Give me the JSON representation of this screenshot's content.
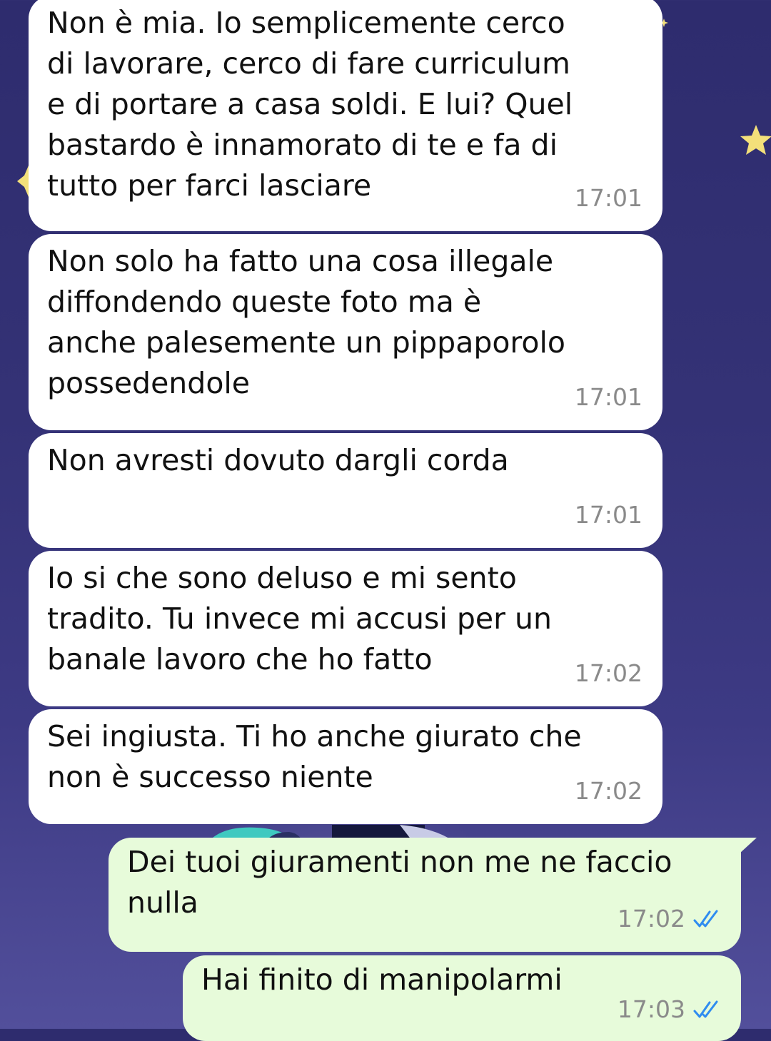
{
  "chat": {
    "messages": [
      {
        "direction": "incoming",
        "text": "Non è mia. Io semplicemente cerco\ndi lavorare, cerco di fare curriculum\ne di portare a casa soldi. E lui? Quel\nbastardo è innamorato di te e fa di\ntutto per farci lasciare",
        "time": "17:01"
      },
      {
        "direction": "incoming",
        "text": "Non solo ha fatto una cosa illegale\ndiffondendo queste foto ma è\nanche palesemente un pippaporolo\npossedendole",
        "time": "17:01"
      },
      {
        "direction": "incoming",
        "text": "Non avresti dovuto dargli corda",
        "time": "17:01"
      },
      {
        "direction": "incoming",
        "text": "Io si che sono deluso e mi sento\ntradito. Tu invece mi accusi per un\nbanale lavoro che ho fatto",
        "time": "17:02"
      },
      {
        "direction": "incoming",
        "text": "Sei ingiusta. Ti ho anche giurato che\nnon è successo niente",
        "time": "17:02"
      },
      {
        "direction": "outgoing",
        "text": "Dei tuoi giuramenti non me ne faccio\nnulla",
        "time": "17:02",
        "status": "read",
        "status_icon": "double-check-icon"
      },
      {
        "direction": "outgoing",
        "text": "Hai finito di manipolarmi",
        "time": "17:03",
        "status": "read",
        "status_icon": "double-check-icon"
      }
    ]
  },
  "colors": {
    "incoming_bubble": "#ffffff",
    "outgoing_bubble": "#e7fbda",
    "read_check": "#2f8cf0",
    "timestamp": "#8a8a8a",
    "wallpaper": "#343276"
  }
}
